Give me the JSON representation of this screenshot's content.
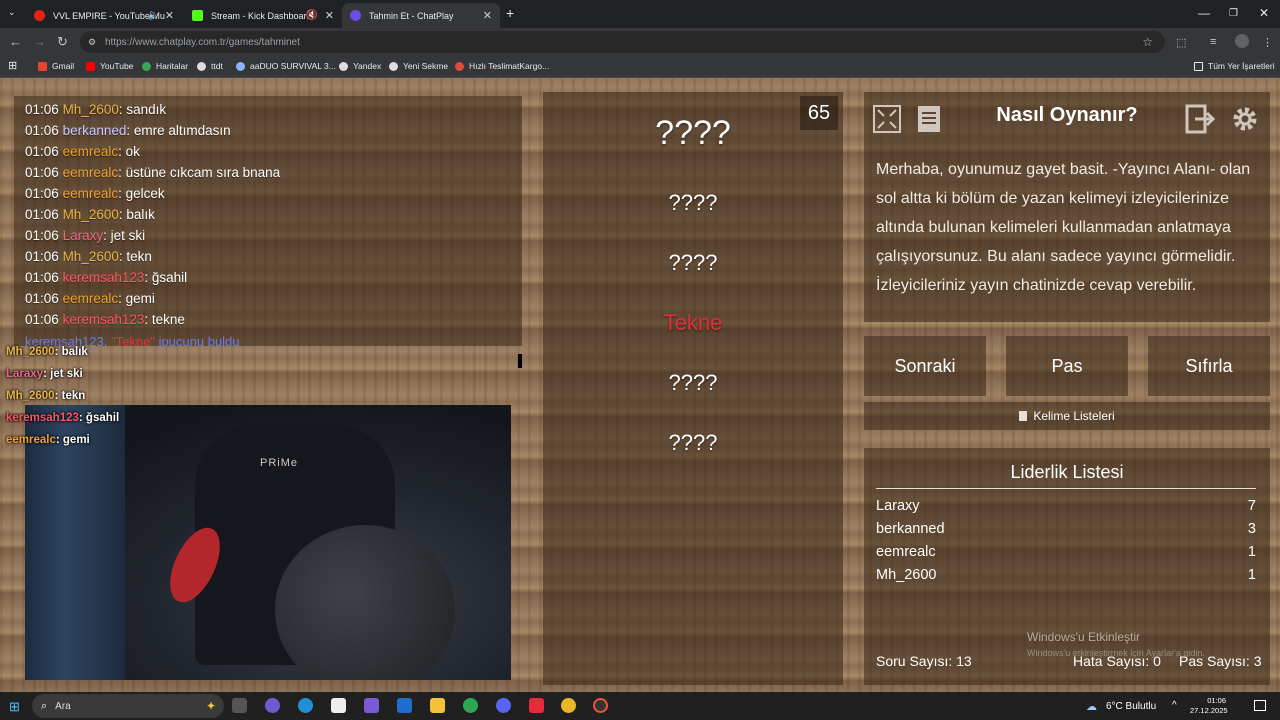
{
  "browser": {
    "tabs": [
      {
        "title": "VVL EMPIRE - YouTube Mu",
        "color": "#e62117"
      },
      {
        "title": "Stream - Kick Dashboard",
        "color": "#53fc18"
      },
      {
        "title": "Tahmin Et - ChatPlay",
        "color": "#6b4de6"
      }
    ],
    "url_host": "https://www.chatplay.com.tr/",
    "url_path": "games/tahminet",
    "bookmarks": [
      "Gmail",
      "YouTube",
      "Haritalar",
      "ttdt",
      "aaDUO SURVIVAL 3...",
      "Yandex",
      "Yeni Sekme",
      "Hızlı TeslimatKargo..."
    ],
    "all_bookmarks": "Tüm Yer İşaretleri"
  },
  "chat": {
    "lines": [
      {
        "time": "01:06",
        "user": "Mh_2600",
        "color": "#e8b448",
        "msg": ": sandık"
      },
      {
        "time": "01:06",
        "user": "berkanned",
        "color": "#c9c7ff",
        "msg": ": emre altımdasın"
      },
      {
        "time": "01:06",
        "user": "eemrealc",
        "color": "#f0a030",
        "msg": ": ok"
      },
      {
        "time": "01:06",
        "user": "eemrealc",
        "color": "#f0a030",
        "msg": ": üstüne cıkcam sıra bnana"
      },
      {
        "time": "01:06",
        "user": "eemrealc",
        "color": "#f0a030",
        "msg": ": gelcek"
      },
      {
        "time": "01:06",
        "user": "Mh_2600",
        "color": "#e8b448",
        "msg": ": balık"
      },
      {
        "time": "01:06",
        "user": "Laraxy",
        "color": "#e86a8a",
        "msg": ": jet ski"
      },
      {
        "time": "01:06",
        "user": "Mh_2600",
        "color": "#e8b448",
        "msg": ": tekn"
      },
      {
        "time": "01:06",
        "user": "keremsah123",
        "color": "#ff5566",
        "msg": ": ğsahil"
      },
      {
        "time": "01:06",
        "user": "eemrealc",
        "color": "#f0a030",
        "msg": ": gemi"
      },
      {
        "time": "01:06",
        "user": "keremsah123",
        "color": "#ff5566",
        "msg": ": tekne"
      }
    ],
    "hint": {
      "user": "keremsah123,",
      "word": "\"Tekne\"",
      "suffix": "ipucunu buldu"
    }
  },
  "stream_overlay": [
    {
      "user": "Mh_2600",
      "msg": ": balık",
      "color": "#e8b448"
    },
    {
      "user": "Laraxy",
      "msg": ": jet ski",
      "color": "#e86a8a"
    },
    {
      "user": "Mh_2600",
      "msg": ": tekn",
      "color": "#e8b448"
    },
    {
      "user": "keremsah123",
      "msg": ": ğsahil",
      "color": "#ff5566"
    },
    {
      "user": "eemrealc",
      "msg": ": gemi",
      "color": "#f0a030"
    }
  ],
  "webcam_text": "PRiMe",
  "game": {
    "timer": "65",
    "main_word": "????",
    "hints": [
      "????",
      "????",
      "Tekne",
      "????",
      "????"
    ],
    "found_color": "#e0303a"
  },
  "howto": {
    "title": "Nasıl Oynanır?",
    "text": "Merhaba, oyunumuz gayet basit. -Yayıncı Alanı- olan sol altta ki bölüm de yazan kelimeyi izleyicilerinize altında bulunan kelimeleri kullanmadan anlatmaya çalışıyorsunuz. Bu alanı sadece yayıncı görmelidir. İzleyicileriniz yayın chatinizde cevap verebilir."
  },
  "buttons": {
    "next": "Sonraki",
    "pass": "Pas",
    "reset": "Sıfırla",
    "word_lists": "Kelime Listeleri"
  },
  "leaderboard": {
    "title": "Liderlik Listesi",
    "rows": [
      {
        "name": "Laraxy",
        "score": "7"
      },
      {
        "name": "berkanned",
        "score": "3"
      },
      {
        "name": "eemrealc",
        "score": "1"
      },
      {
        "name": "Mh_2600",
        "score": "1"
      }
    ],
    "questions": "Soru Sayısı: 13",
    "errors": "Hata Sayısı: 0",
    "passes": "Pas Sayısı: 3"
  },
  "watermark": {
    "line1": "Windows'u Etkinleştir",
    "line2": "Windows'u etkinleştirmek için Ayarlar'a gidin."
  },
  "taskbar": {
    "search": "Ara",
    "weather": "6°C  Bulutlu",
    "time": "01:06",
    "date": "27.12.2025"
  }
}
